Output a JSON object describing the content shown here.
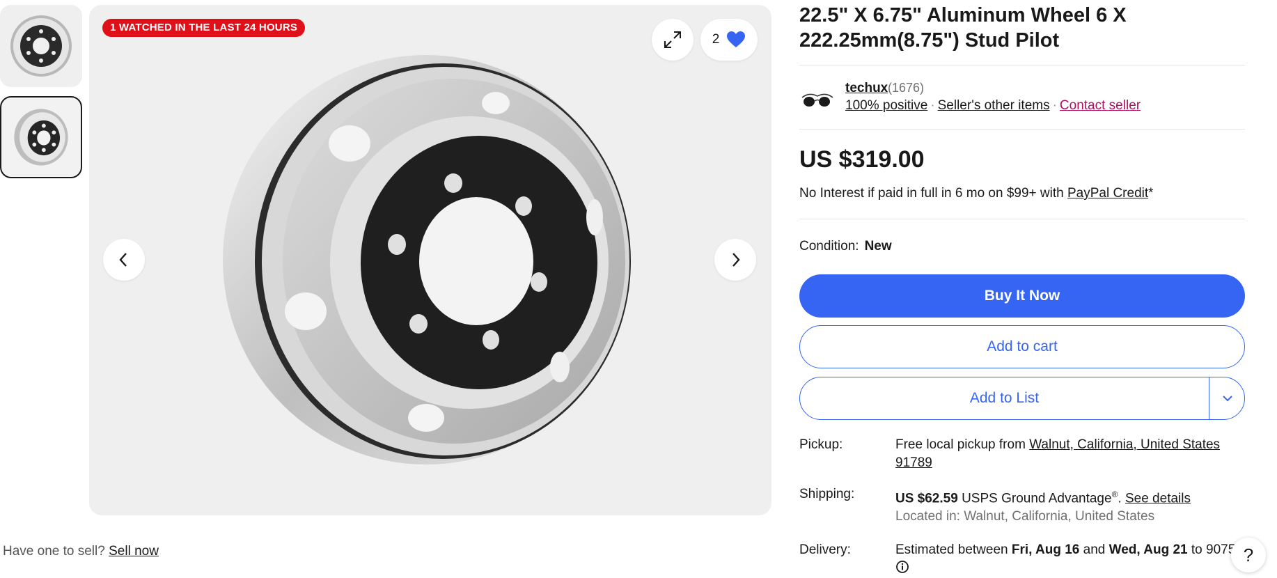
{
  "gallery": {
    "badge": "1 WATCHED IN THE LAST 24 HOURS",
    "watch_count": "2",
    "icons": [
      "expand-icon",
      "heart-icon",
      "chevron-left-icon",
      "chevron-right-icon"
    ]
  },
  "sell": {
    "prompt": "Have one to sell?",
    "link": "Sell now"
  },
  "listing": {
    "title_line1": "22.5\" X 6.75\" Aluminum Wheel 6 X",
    "title_line2": "222.25mm(8.75\") Stud Pilot"
  },
  "seller": {
    "name": "techux",
    "count": "(1676)",
    "positive": "100% positive",
    "other_items": "Seller's other items",
    "contact": "Contact seller"
  },
  "price": {
    "value": "US $319.00",
    "credit_text": "No Interest if paid in full in 6 mo on $99+ with",
    "credit_link": "PayPal Credit",
    "credit_suffix": "*"
  },
  "condition": {
    "label": "Condition:",
    "value": "New"
  },
  "actions": {
    "buy": "Buy It Now",
    "cart": "Add to cart",
    "list": "Add to List"
  },
  "pickup": {
    "label": "Pickup:",
    "text": "Free local pickup from",
    "location_link": "Walnut, California, United States 91789"
  },
  "shipping": {
    "label": "Shipping:",
    "cost": "US $62.59",
    "service": "USPS Ground Advantage",
    "reg": "®",
    "period": ".",
    "details_link": "See details",
    "located": "Located in: Walnut, California, United States"
  },
  "delivery": {
    "label": "Delivery:",
    "text_prefix": "Estimated between",
    "date_from": "Fri, Aug 16",
    "and": "and",
    "date_to": "Wed, Aug 21",
    "to": "to",
    "zip": "90755"
  },
  "help": {
    "label": "?"
  },
  "colors": {
    "accent": "#3665f3",
    "badge": "#e0101a",
    "contact_link": "#b01061"
  }
}
